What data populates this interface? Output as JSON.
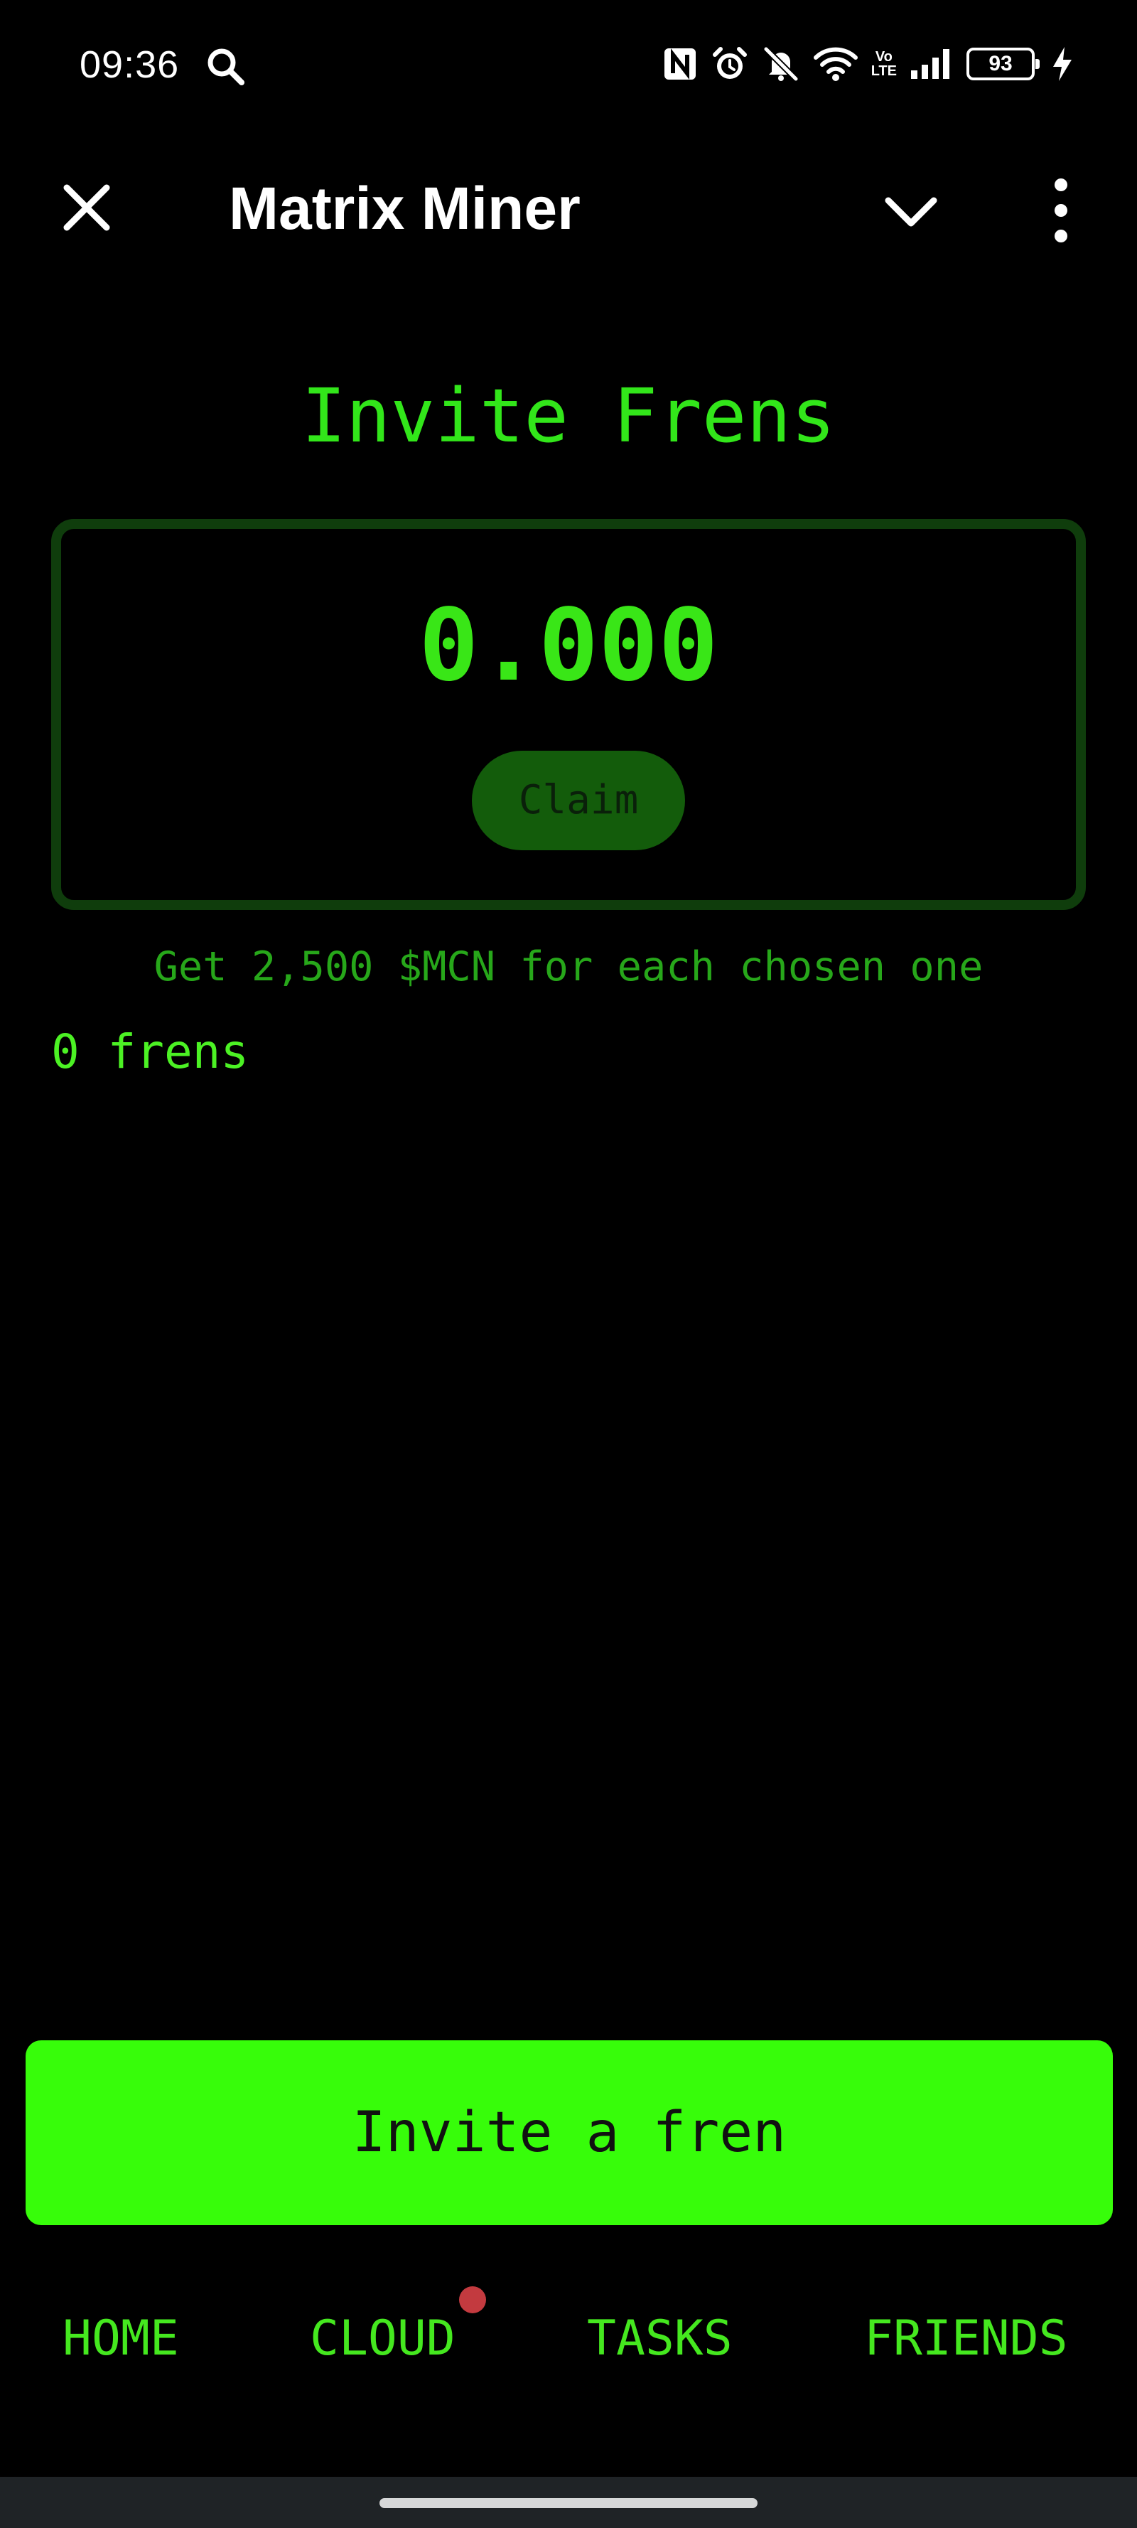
{
  "status_bar": {
    "time": "09:36",
    "battery_level": "93",
    "volte": "Vo\nLTE",
    "icons": [
      "search-icon",
      "nfc-icon",
      "alarm-icon",
      "mute-icon",
      "wifi-icon",
      "volte-icon",
      "signal-icon",
      "battery-icon",
      "charging-icon"
    ]
  },
  "header": {
    "title": "Matrix Miner",
    "icons": [
      "close-icon",
      "chevron-down-icon",
      "more-vertical-icon"
    ]
  },
  "main": {
    "page_title": "Invite Frens",
    "claim_amount": "0.000",
    "claim_label": "Claim",
    "reward_note": "Get 2,500 $MCN for each chosen one",
    "frens_count": "0 frens"
  },
  "invite": {
    "label": "Invite a fren"
  },
  "bottom_nav": {
    "items": [
      {
        "label": "HOME"
      },
      {
        "label": "CLOUD",
        "has_notification": true
      },
      {
        "label": "TASKS"
      },
      {
        "label": "FRIENDS"
      }
    ]
  },
  "colors": {
    "accent": "#37fd0a",
    "text_green": "#39e617",
    "muted_green": "#27a71a",
    "card_border": "#0f3d0c",
    "claim_button": "#135c0b",
    "notification_dot": "#c33a3f",
    "background": "#000000"
  }
}
